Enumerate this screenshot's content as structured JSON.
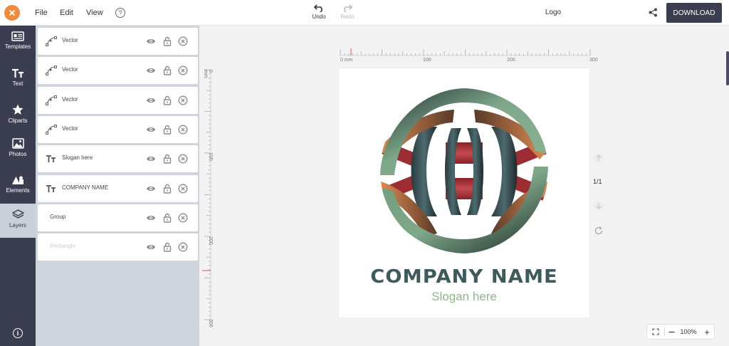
{
  "topbar": {
    "menu": [
      "File",
      "Edit",
      "View"
    ],
    "help": "?",
    "undo_label": "Undo",
    "redo_label": "Redo",
    "doc_title": "Logo",
    "download_label": "DOWNLOAD"
  },
  "leftnav": {
    "items": [
      {
        "label": "Templates",
        "icon": "templates-icon"
      },
      {
        "label": "Text",
        "icon": "text-icon"
      },
      {
        "label": "Cliparts",
        "icon": "star-icon"
      },
      {
        "label": "Photos",
        "icon": "photo-icon"
      },
      {
        "label": "Elements",
        "icon": "shapes-icon"
      },
      {
        "label": "Layers",
        "icon": "layers-icon",
        "active": true
      }
    ],
    "info": "i"
  },
  "layers": [
    {
      "label": "Vector",
      "type": "vector"
    },
    {
      "label": "Vector",
      "type": "vector"
    },
    {
      "label": "Vector",
      "type": "vector"
    },
    {
      "label": "Vector",
      "type": "vector"
    },
    {
      "label": "Slogan here",
      "type": "text"
    },
    {
      "label": "COMPANY NAME",
      "type": "text"
    },
    {
      "label": "Group",
      "type": "group"
    },
    {
      "label": "Rectangle",
      "type": "rectangle",
      "hidden": true
    }
  ],
  "rulers": {
    "horizontal": [
      "0 mm",
      "100",
      "200",
      "300"
    ],
    "vertical": [
      "0 mm",
      "100",
      "200",
      "300"
    ]
  },
  "canvas": {
    "company_name": "COMPANY NAME",
    "slogan": "Slogan here",
    "colors": {
      "green": "#7fa88a",
      "dark": "#2f3b3c",
      "orange": "#d98a4e",
      "red": "#a8333a",
      "slate": "#3f5a5c"
    }
  },
  "page_indicator": "1/1",
  "zoom": {
    "level": "100%",
    "minus": "—",
    "plus": "+"
  }
}
